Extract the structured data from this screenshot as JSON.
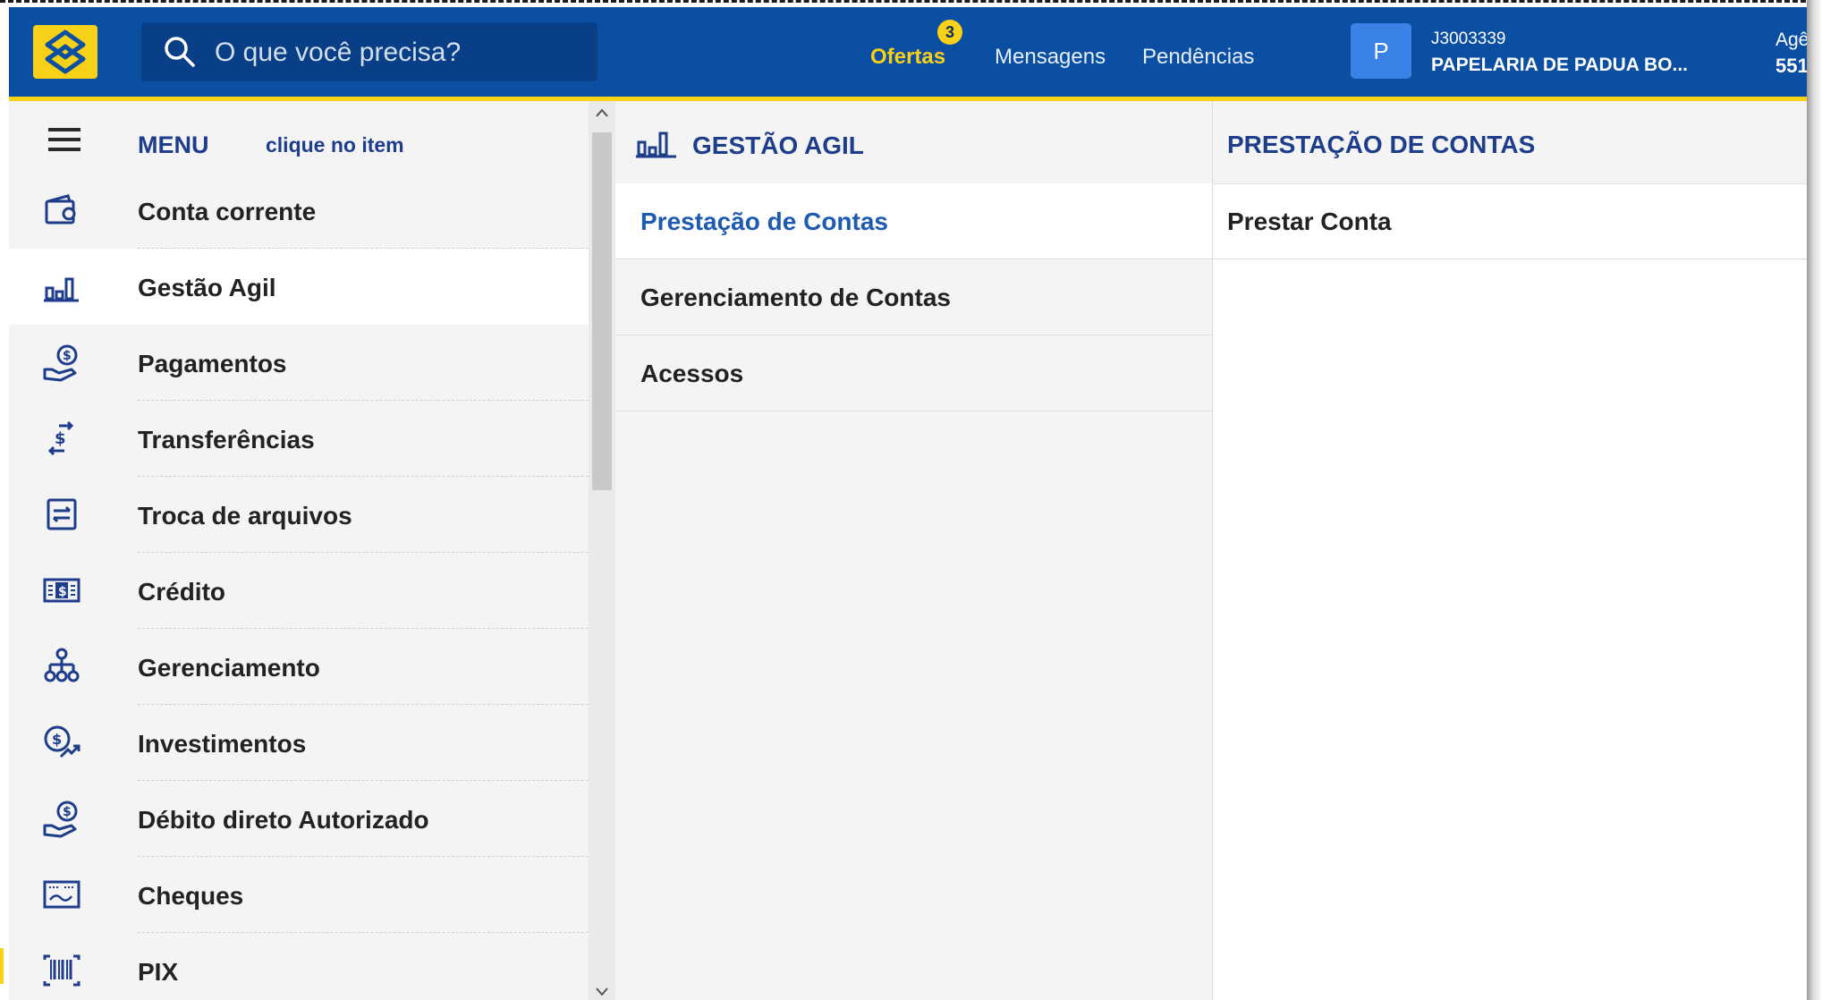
{
  "header": {
    "search_placeholder": "O que você precisa?",
    "nav": {
      "ofertas": "Ofertas",
      "ofertas_badge": "3",
      "mensagens": "Mensagens",
      "pendencias": "Pendências"
    },
    "user": {
      "avatar_letter": "P",
      "id": "J3003339",
      "name": "PAPELARIA DE PADUA BO...",
      "agency_label": "Agê",
      "agency_number": "551"
    }
  },
  "sidebar": {
    "menu_label": "MENU",
    "menu_hint": "clique no item",
    "items": [
      {
        "label": "Conta corrente",
        "icon": "wallet-icon"
      },
      {
        "label": "Gestão Agil",
        "icon": "bar-chart-icon",
        "active": true
      },
      {
        "label": "Pagamentos",
        "icon": "hand-coin-icon"
      },
      {
        "label": "Transferências",
        "icon": "transfer-arrows-icon"
      },
      {
        "label": "Troca de arquivos",
        "icon": "file-exchange-icon"
      },
      {
        "label": "Crédito",
        "icon": "money-note-icon"
      },
      {
        "label": "Gerenciamento",
        "icon": "org-chart-icon"
      },
      {
        "label": "Investimentos",
        "icon": "coin-growth-icon"
      },
      {
        "label": "Débito direto Autorizado",
        "icon": "hand-coin-icon"
      },
      {
        "label": "Cheques",
        "icon": "check-icon"
      },
      {
        "label": "PIX",
        "icon": "barcode-icon"
      }
    ]
  },
  "panel_gestao": {
    "title": "GESTÃO AGIL",
    "items": [
      {
        "label": "Prestação de Contas",
        "active": true
      },
      {
        "label": "Gerenciamento de Contas"
      },
      {
        "label": "Acessos"
      }
    ]
  },
  "panel_prestacao": {
    "title": "PRESTAÇÃO DE CONTAS",
    "items": [
      {
        "label": "Prestar Conta"
      }
    ]
  },
  "colors": {
    "header_blue": "#0b4fa3",
    "brand_yellow": "#f7d117",
    "menu_blue": "#1e3d8a",
    "active_link_blue": "#1e5bb0"
  }
}
